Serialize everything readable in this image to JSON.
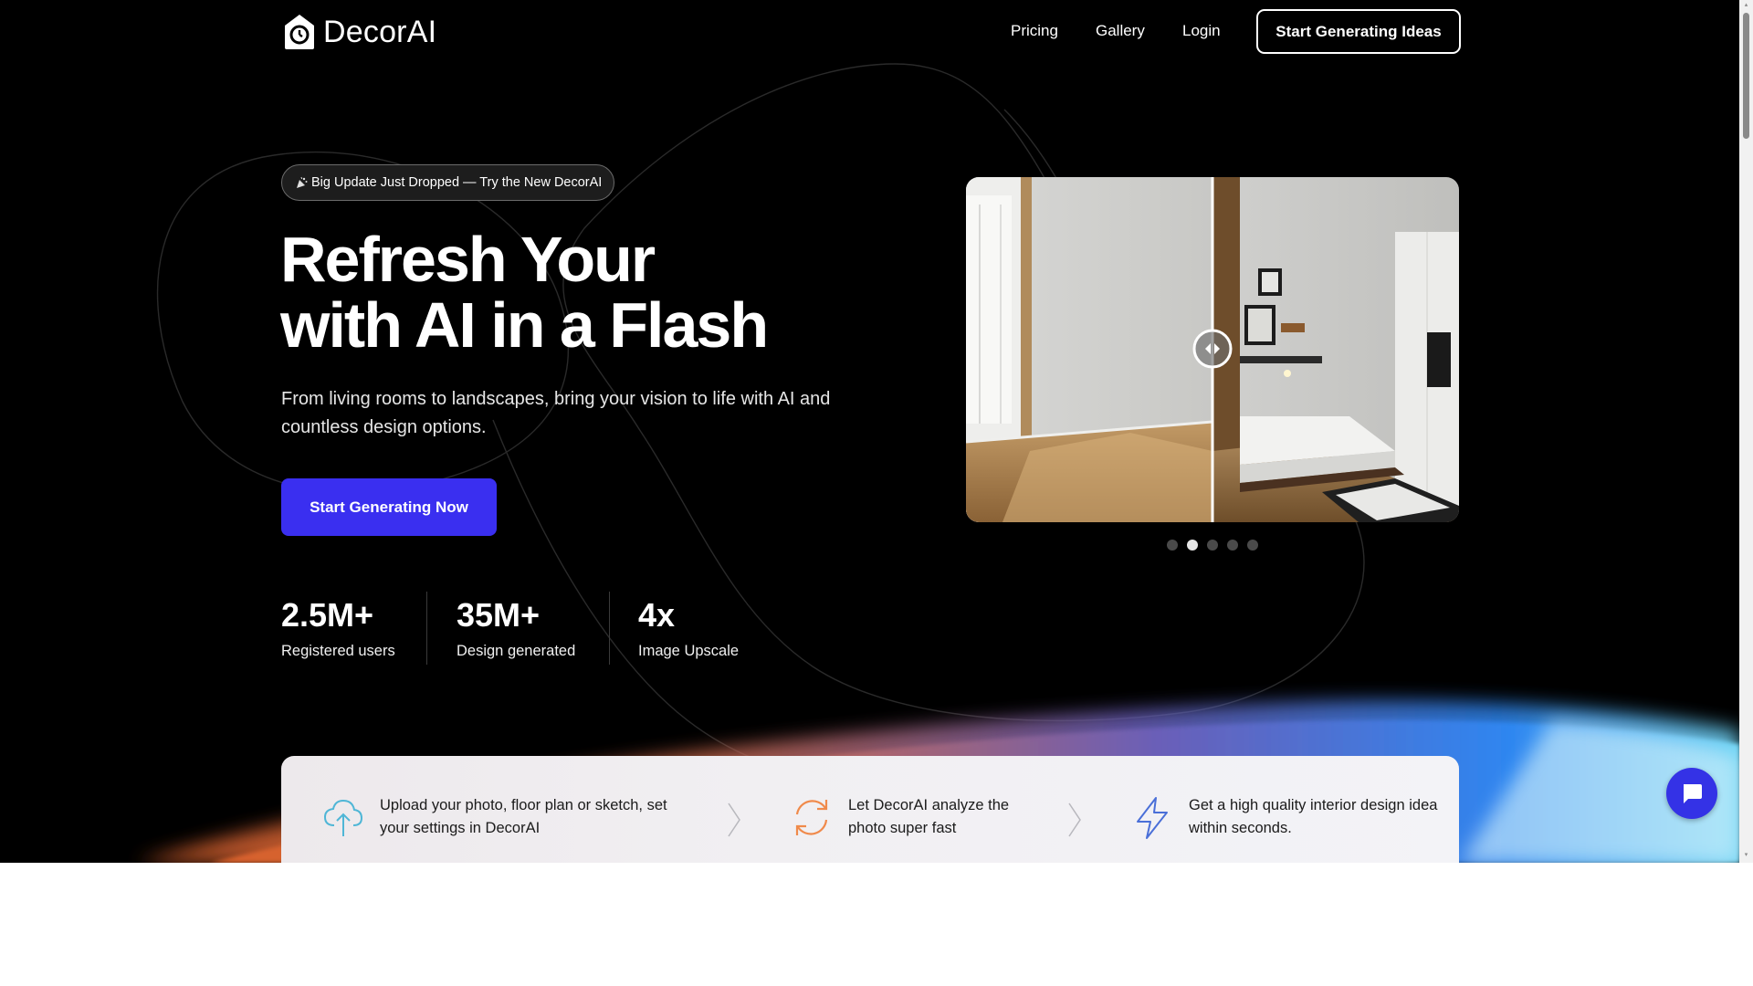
{
  "brand": {
    "name": "DecorAI"
  },
  "nav": {
    "links": [
      {
        "label": "Pricing"
      },
      {
        "label": "Gallery"
      },
      {
        "label": "Login"
      }
    ],
    "cta_label": "Start Generating Ideas"
  },
  "hero": {
    "badge_text": "Big Update Just Dropped — Try the New DecorAI",
    "title_line1": "Refresh Your",
    "title_line2": "with AI in a Flash",
    "subtitle": "From living rooms to landscapes, bring your vision to life with AI and countless design options.",
    "cta_label": "Start Generating Now"
  },
  "stats": [
    {
      "value": "2.5M+",
      "label": "Registered users"
    },
    {
      "value": "35M+",
      "label": "Design generated"
    },
    {
      "value": "4x",
      "label": "Image Upscale"
    }
  ],
  "carousel": {
    "slide_count": 5,
    "active_index": 1
  },
  "steps": [
    {
      "text": "Upload your photo, floor plan or sketch, set your settings in DecorAI",
      "icon": "cloud-upload-icon"
    },
    {
      "text": "Let DecorAI analyze the photo super fast",
      "icon": "refresh-icon"
    },
    {
      "text": "Get a high quality interior design idea within seconds.",
      "icon": "lightning-icon"
    }
  ],
  "colors": {
    "background": "#000000",
    "primary_button": "#3a2ff0",
    "chat_button": "#3432e6",
    "upload_icon": "#4fb6d6",
    "refresh_icon": "#f08a4b",
    "lightning_icon": "#4a6fd8"
  }
}
